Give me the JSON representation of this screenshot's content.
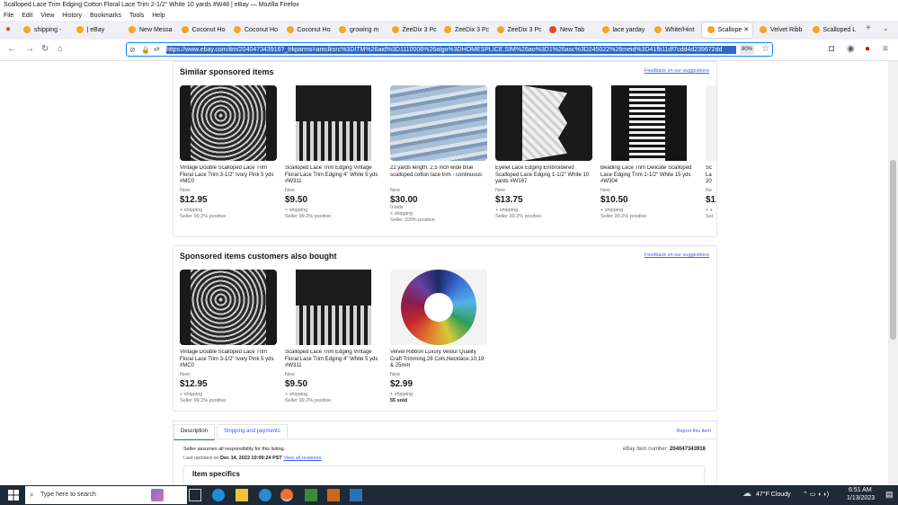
{
  "window": {
    "title": "Scalloped Lace Trim Edging Cotton Floral Lace Trim 2-1/2\" White 10 yards #W48 | eBay — Mozilla Firefox"
  },
  "menu": [
    "File",
    "Edit",
    "View",
    "History",
    "Bookmarks",
    "Tools",
    "Help"
  ],
  "tabs": [
    {
      "label": "shipping - ",
      "color": "#f5a623"
    },
    {
      "label": "| eBay",
      "color": "#f5a623"
    },
    {
      "label": "New Messa",
      "color": "#f5a623"
    },
    {
      "label": "Coconut Ho",
      "color": "#f5a623"
    },
    {
      "label": "Coconut Ho",
      "color": "#f5a623"
    },
    {
      "label": "Coconut Ho",
      "color": "#f5a623"
    },
    {
      "label": "growing m",
      "color": "#f5a623"
    },
    {
      "label": "ZeeDix 3 Pc",
      "color": "#f5a623"
    },
    {
      "label": "ZeeDix 3 Pc",
      "color": "#f5a623"
    },
    {
      "label": "ZeeDix 3 Pc",
      "color": "#f5a623"
    },
    {
      "label": "New Tab",
      "color": "#e34b2c"
    },
    {
      "label": "lace yarday",
      "color": "#f5a623"
    },
    {
      "label": "White/Hint",
      "color": "#f5a623"
    },
    {
      "label": "Scallope",
      "color": "#f5a623"
    },
    {
      "label": "Velvet Ribb",
      "color": "#f5a623"
    },
    {
      "label": "Scalloped L",
      "color": "#f5a623"
    }
  ],
  "url": "https://www.ebay.com/itm/204047343916?_trkparms=amclksrc%3DITM%26aid%3D1110006%26algo%3DHOMESPLICE.SIM%26ao%3D1%26asc%3D245022%26meid%3D41fb11df7cdd4d239672dd",
  "zoom": "80%",
  "similar": {
    "title": "Similar sponsored items",
    "feedback": "Feedback on our suggestions",
    "items": [
      {
        "title": "Vintage Double Scalloped Lace Trim Floral Lace Trim 3-1/2\" Ivory Pink 5 yds #MC0",
        "cond": "New",
        "price": "$12.95",
        "extra": "",
        "ship": "+ shipping",
        "seller": "Seller 99.2% positive"
      },
      {
        "title": "Scalloped Lace Trim Edging Vintage Floral Lace Trim Edging 4\" White 5 yds #W311",
        "cond": "New",
        "price": "$9.50",
        "extra": "",
        "ship": "+ shipping",
        "seller": "Seller 99.2% positive"
      },
      {
        "title": "22 yards length, 2.5 inch wide blue scalloped cotton lace trim - continuous",
        "cond": "New",
        "price": "$30.00",
        "extra": "0 bids",
        "ship": "+ shipping",
        "seller": "Seller 100% positive"
      },
      {
        "title": "Eyelet Lace Edging Embroidered Scalloped Lace Edging 1-1/2\" White 10 yards #W167",
        "cond": "New",
        "price": "$13.75",
        "extra": "",
        "ship": "+ shipping",
        "seller": "Seller 99.2% positive"
      },
      {
        "title": "Beading Lace Trim Delicate Scalloped Lace Edging Trim 1-1/2\" White 15 yds #W304",
        "cond": "New",
        "price": "$10.50",
        "extra": "",
        "ship": "+ shipping",
        "seller": "Seller 99.2% positive"
      },
      {
        "title": "Sc La 20",
        "cond": "Ne",
        "price": "$1",
        "extra": "",
        "ship": "+ s",
        "seller": "Sel"
      }
    ]
  },
  "also": {
    "title": "Sponsored items customers also bought",
    "feedback": "Feedback on our suggestions",
    "items": [
      {
        "title": "Vintage Double Scalloped Lace Trim Floral Lace Trim 3-1/2\" Ivory Pink 5 yds #MC0",
        "cond": "New",
        "price": "$12.95",
        "ship": "+ shipping",
        "seller": "Seller 99.2% positive"
      },
      {
        "title": "Scalloped Lace Trim Edging Vintage Floral Lace Trim Edging 4\" White 5 yds #W311",
        "cond": "New",
        "price": "$9.50",
        "ship": "+ shipping",
        "seller": "Seller 99.2% positive"
      },
      {
        "title": "Velvet Ribbon Luxury Velour Quality Craft Trimming,28 Cols,Necklace,10,19 & 25mm",
        "cond": "New",
        "price": "$2.99",
        "ship": "+ shipping",
        "seller": "55 sold"
      }
    ]
  },
  "desc": {
    "tab1": "Description",
    "tab2": "Shipping and payments",
    "report": "Report this item",
    "seller_resp": "Seller assumes all responsibility for this listing.",
    "item_num_label": "eBay item number:",
    "item_num": "204047343916",
    "updated_label": "Last updated on",
    "updated_value": "Dec 14, 2022 10:09:24 PST",
    "revisions": "View all revisions",
    "specifics": "Item specifics"
  },
  "taskbar": {
    "search": "Type here to search",
    "weather": "47°F  Cloudy",
    "time": "6:51 AM",
    "date": "1/13/2023"
  }
}
